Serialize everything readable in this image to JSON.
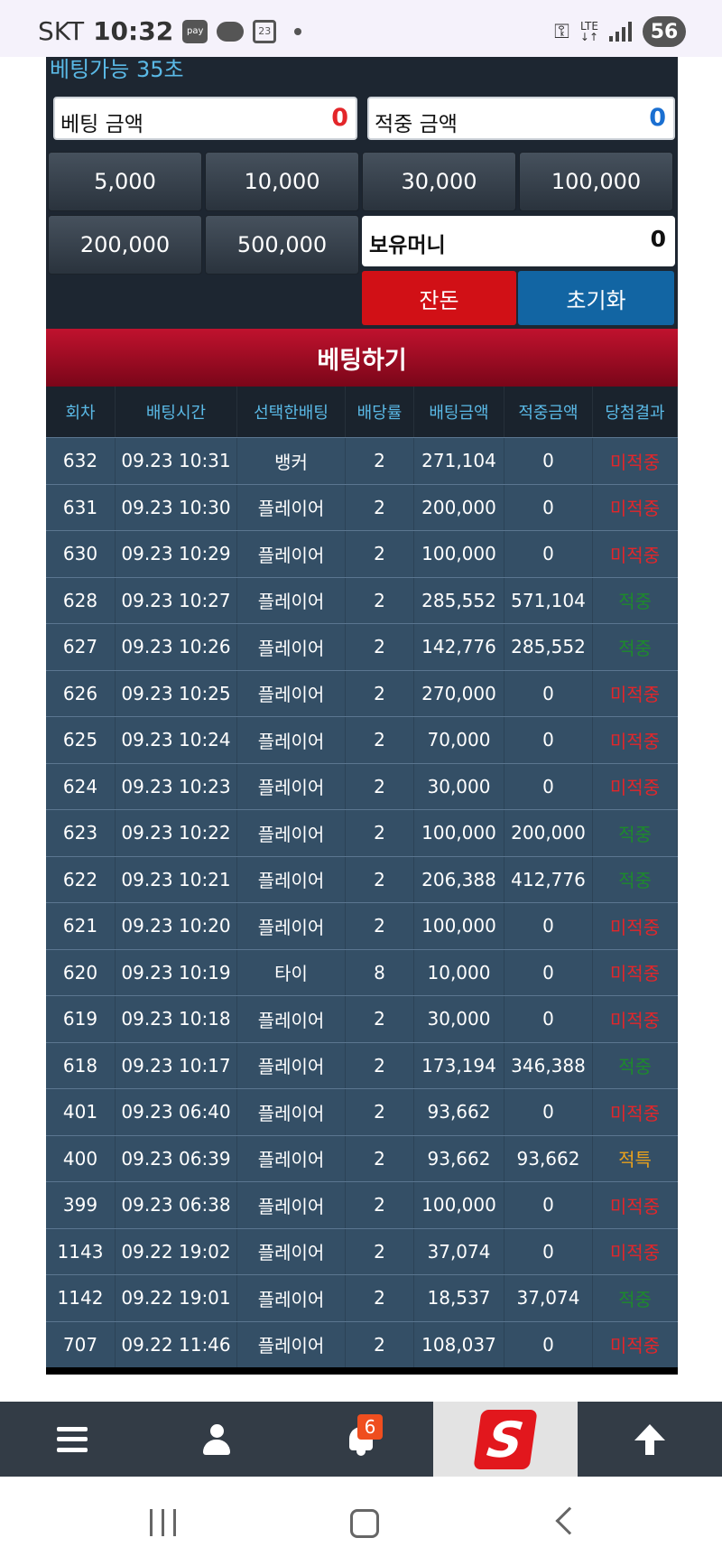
{
  "status_bar": {
    "carrier": "SKT",
    "time": "10:32",
    "pay": "pay",
    "calendar": "23",
    "lte": "LTE",
    "battery": "56"
  },
  "bet_panel": {
    "available": "베팅가능 35초",
    "bet_amount_label": "베팅 금액",
    "bet_amount_value": "0",
    "win_amount_label": "적중 금액",
    "win_amount_value": "0",
    "chips": [
      "5,000",
      "10,000",
      "30,000",
      "100,000",
      "200,000",
      "500,000"
    ],
    "money_label": "보유머니",
    "money_value": "0",
    "balance_button": "잔돈",
    "reset_button": "초기화",
    "bet_button": "베팅하기"
  },
  "colors": {
    "lose": "#e3262a",
    "win": "#1d8a2c",
    "special": "#e9a11c",
    "header_text": "#5ab9e6"
  },
  "table": {
    "headers": [
      "회차",
      "배팅시간",
      "선택한배팅",
      "배당률",
      "배팅금액",
      "적중금액",
      "당첨결과"
    ],
    "rows": [
      {
        "round": "632",
        "time": "09.23 10:31",
        "pick": "뱅커",
        "odds": "2",
        "bet": "271,104",
        "win": "0",
        "result": "미적중",
        "status": "lose"
      },
      {
        "round": "631",
        "time": "09.23 10:30",
        "pick": "플레이어",
        "odds": "2",
        "bet": "200,000",
        "win": "0",
        "result": "미적중",
        "status": "lose"
      },
      {
        "round": "630",
        "time": "09.23 10:29",
        "pick": "플레이어",
        "odds": "2",
        "bet": "100,000",
        "win": "0",
        "result": "미적중",
        "status": "lose"
      },
      {
        "round": "628",
        "time": "09.23 10:27",
        "pick": "플레이어",
        "odds": "2",
        "bet": "285,552",
        "win": "571,104",
        "result": "적중",
        "status": "win"
      },
      {
        "round": "627",
        "time": "09.23 10:26",
        "pick": "플레이어",
        "odds": "2",
        "bet": "142,776",
        "win": "285,552",
        "result": "적중",
        "status": "win"
      },
      {
        "round": "626",
        "time": "09.23 10:25",
        "pick": "플레이어",
        "odds": "2",
        "bet": "270,000",
        "win": "0",
        "result": "미적중",
        "status": "lose"
      },
      {
        "round": "625",
        "time": "09.23 10:24",
        "pick": "플레이어",
        "odds": "2",
        "bet": "70,000",
        "win": "0",
        "result": "미적중",
        "status": "lose"
      },
      {
        "round": "624",
        "time": "09.23 10:23",
        "pick": "플레이어",
        "odds": "2",
        "bet": "30,000",
        "win": "0",
        "result": "미적중",
        "status": "lose"
      },
      {
        "round": "623",
        "time": "09.23 10:22",
        "pick": "플레이어",
        "odds": "2",
        "bet": "100,000",
        "win": "200,000",
        "result": "적중",
        "status": "win"
      },
      {
        "round": "622",
        "time": "09.23 10:21",
        "pick": "플레이어",
        "odds": "2",
        "bet": "206,388",
        "win": "412,776",
        "result": "적중",
        "status": "win"
      },
      {
        "round": "621",
        "time": "09.23 10:20",
        "pick": "플레이어",
        "odds": "2",
        "bet": "100,000",
        "win": "0",
        "result": "미적중",
        "status": "lose"
      },
      {
        "round": "620",
        "time": "09.23 10:19",
        "pick": "타이",
        "odds": "8",
        "bet": "10,000",
        "win": "0",
        "result": "미적중",
        "status": "lose"
      },
      {
        "round": "619",
        "time": "09.23 10:18",
        "pick": "플레이어",
        "odds": "2",
        "bet": "30,000",
        "win": "0",
        "result": "미적중",
        "status": "lose"
      },
      {
        "round": "618",
        "time": "09.23 10:17",
        "pick": "플레이어",
        "odds": "2",
        "bet": "173,194",
        "win": "346,388",
        "result": "적중",
        "status": "win"
      },
      {
        "round": "401",
        "time": "09.23 06:40",
        "pick": "플레이어",
        "odds": "2",
        "bet": "93,662",
        "win": "0",
        "result": "미적중",
        "status": "lose"
      },
      {
        "round": "400",
        "time": "09.23 06:39",
        "pick": "플레이어",
        "odds": "2",
        "bet": "93,662",
        "win": "93,662",
        "result": "적특",
        "status": "special"
      },
      {
        "round": "399",
        "time": "09.23 06:38",
        "pick": "플레이어",
        "odds": "2",
        "bet": "100,000",
        "win": "0",
        "result": "미적중",
        "status": "lose"
      },
      {
        "round": "1143",
        "time": "09.22 19:02",
        "pick": "플레이어",
        "odds": "2",
        "bet": "37,074",
        "win": "0",
        "result": "미적중",
        "status": "lose"
      },
      {
        "round": "1142",
        "time": "09.22 19:01",
        "pick": "플레이어",
        "odds": "2",
        "bet": "18,537",
        "win": "37,074",
        "result": "적중",
        "status": "win"
      },
      {
        "round": "707",
        "time": "09.22 11:46",
        "pick": "플레이어",
        "odds": "2",
        "bet": "108,037",
        "win": "0",
        "result": "미적중",
        "status": "lose"
      }
    ]
  },
  "bottom_nav": {
    "notification_count": "6",
    "logo": "S"
  }
}
